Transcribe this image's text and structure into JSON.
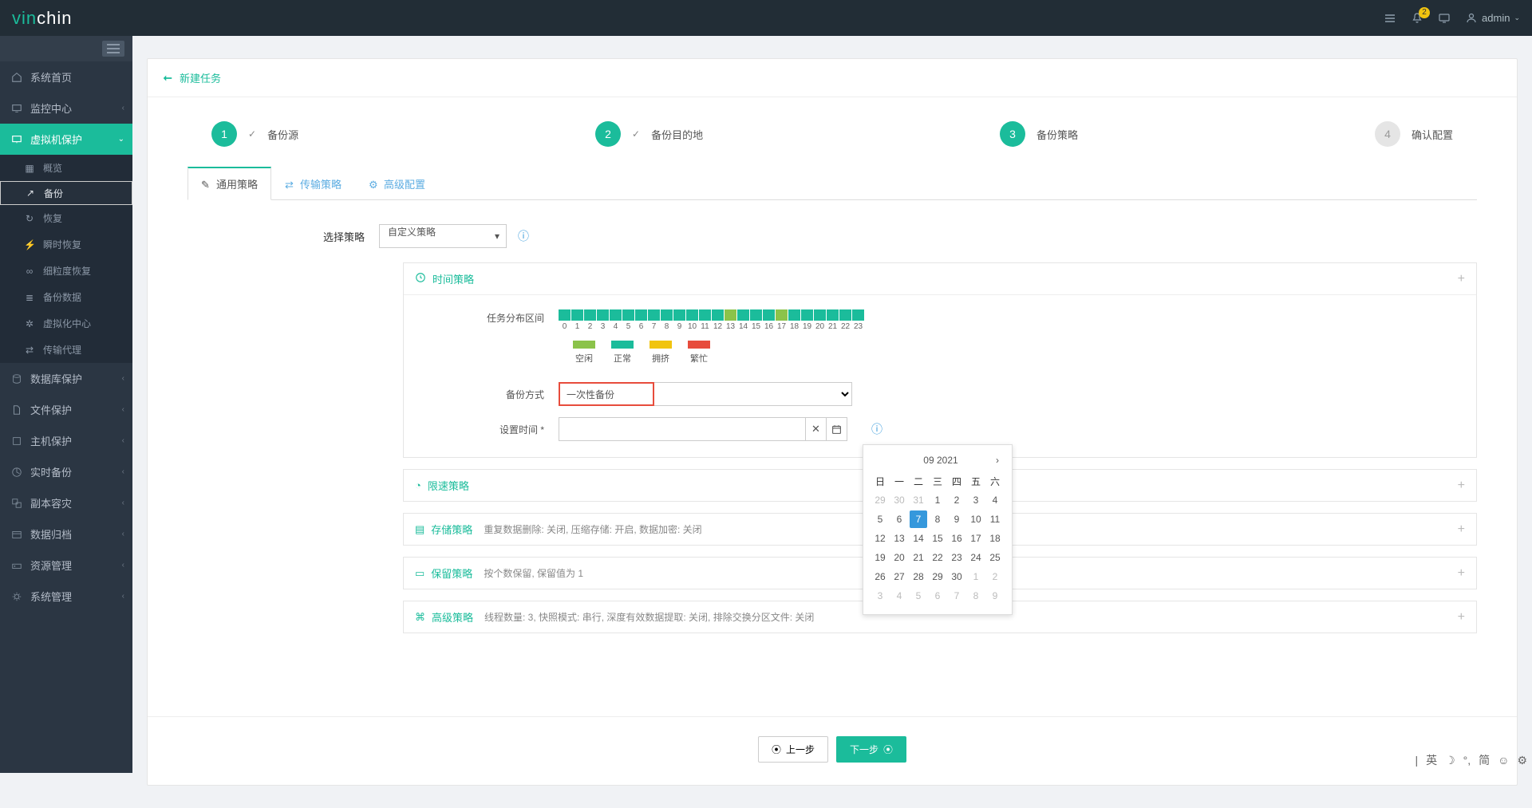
{
  "brand": {
    "part1": "vin",
    "part2": "chin"
  },
  "topbar": {
    "notification_count": "2",
    "user": "admin"
  },
  "sidebar": {
    "items": [
      {
        "icon": "home-icon",
        "label": "系统首页"
      },
      {
        "icon": "monitor-icon",
        "label": "监控中心",
        "expandable": true
      },
      {
        "icon": "desktop-icon",
        "label": "虚拟机保护",
        "expandable": true,
        "active": true,
        "children": [
          {
            "icon": "overview-icon",
            "label": "概览"
          },
          {
            "icon": "backup-icon",
            "label": "备份",
            "selected": true
          },
          {
            "icon": "restore-icon",
            "label": "恢复"
          },
          {
            "icon": "instant-icon",
            "label": "瞬时恢复"
          },
          {
            "icon": "granular-icon",
            "label": "细粒度恢复"
          },
          {
            "icon": "data-icon",
            "label": "备份数据"
          },
          {
            "icon": "virt-icon",
            "label": "虚拟化中心"
          },
          {
            "icon": "agent-icon",
            "label": "传输代理"
          }
        ]
      },
      {
        "icon": "db-icon",
        "label": "数据库保护",
        "expandable": true
      },
      {
        "icon": "file-icon",
        "label": "文件保护",
        "expandable": true
      },
      {
        "icon": "host-icon",
        "label": "主机保护",
        "expandable": true
      },
      {
        "icon": "realtime-icon",
        "label": "实时备份",
        "expandable": true
      },
      {
        "icon": "replica-icon",
        "label": "副本容灾",
        "expandable": true
      },
      {
        "icon": "archive-icon",
        "label": "数据归档",
        "expandable": true
      },
      {
        "icon": "resource-icon",
        "label": "资源管理",
        "expandable": true
      },
      {
        "icon": "system-icon",
        "label": "系统管理",
        "expandable": true
      }
    ]
  },
  "page_title": "新建任务",
  "steps": [
    {
      "num": "1",
      "label": "备份源",
      "state": "done"
    },
    {
      "num": "2",
      "label": "备份目的地",
      "state": "done"
    },
    {
      "num": "3",
      "label": "备份策略",
      "state": "active"
    },
    {
      "num": "4",
      "label": "确认配置",
      "state": "pending"
    }
  ],
  "tabs": [
    {
      "icon": "pencil-icon",
      "label": "通用策略",
      "active": true
    },
    {
      "icon": "transfer-icon",
      "label": "传输策略"
    },
    {
      "icon": "gear-icon",
      "label": "高级配置"
    }
  ],
  "policy_select": {
    "label": "选择策略",
    "value": "自定义策略"
  },
  "time_section": {
    "title": "时间策略",
    "dist_label": "任务分布区间",
    "legend": [
      {
        "color": "#8bc34a",
        "label": "空闲"
      },
      {
        "color": "#1bbc9b",
        "label": "正常"
      },
      {
        "color": "#f1c40f",
        "label": "拥挤"
      },
      {
        "color": "#e74c3c",
        "label": "繁忙"
      }
    ],
    "backup_mode": {
      "label": "备份方式",
      "value": "一次性备份"
    },
    "set_time": {
      "label": "设置时间",
      "value": ""
    }
  },
  "collapsed_sections": [
    {
      "icon": "speed-icon",
      "title": "限速策略",
      "desc": ""
    },
    {
      "icon": "storage-icon",
      "title": "存储策略",
      "desc": "重复数据删除: 关闭, 压缩存储: 开启, 数据加密: 关闭"
    },
    {
      "icon": "retain-icon",
      "title": "保留策略",
      "desc": "按个数保留, 保留值为 1"
    },
    {
      "icon": "adv-icon",
      "title": "高级策略",
      "desc": "线程数量: 3, 快照模式: 串行, 深度有效数据提取: 关闭, 排除交换分区文件: 关闭"
    }
  ],
  "calendar": {
    "title": "09 2021",
    "dow": [
      "日",
      "一",
      "二",
      "三",
      "四",
      "五",
      "六"
    ],
    "weeks": [
      [
        "29",
        "30",
        "31",
        "1",
        "2",
        "3",
        "4"
      ],
      [
        "5",
        "6",
        "7",
        "8",
        "9",
        "10",
        "11"
      ],
      [
        "12",
        "13",
        "14",
        "15",
        "16",
        "17",
        "18"
      ],
      [
        "19",
        "20",
        "21",
        "22",
        "23",
        "24",
        "25"
      ],
      [
        "26",
        "27",
        "28",
        "29",
        "30",
        "1",
        "2"
      ],
      [
        "3",
        "4",
        "5",
        "6",
        "7",
        "8",
        "9"
      ]
    ],
    "muted_rows": {
      "0": [
        0,
        1,
        2
      ],
      "4": [
        5,
        6
      ],
      "5": [
        0,
        1,
        2,
        3,
        4,
        5,
        6
      ]
    },
    "today": "7"
  },
  "chart_data": {
    "type": "bar",
    "title": "任务分布区间",
    "categories": [
      "0",
      "1",
      "2",
      "3",
      "4",
      "5",
      "6",
      "7",
      "8",
      "9",
      "10",
      "11",
      "12",
      "13",
      "14",
      "15",
      "16",
      "17",
      "18",
      "19",
      "20",
      "21",
      "22",
      "23"
    ],
    "values": [
      "正常",
      "正常",
      "正常",
      "正常",
      "正常",
      "正常",
      "正常",
      "正常",
      "正常",
      "正常",
      "正常",
      "正常",
      "正常",
      "空闲",
      "正常",
      "正常",
      "正常",
      "空闲",
      "正常",
      "正常",
      "正常",
      "正常",
      "正常",
      "正常"
    ],
    "color_map": {
      "空闲": "#8bc34a",
      "正常": "#1bbc9b",
      "拥挤": "#f1c40f",
      "繁忙": "#e74c3c"
    },
    "xlabel": "",
    "ylabel": ""
  },
  "buttons": {
    "prev": "上一步",
    "next": "下一步"
  },
  "ime": [
    "英",
    "简"
  ]
}
